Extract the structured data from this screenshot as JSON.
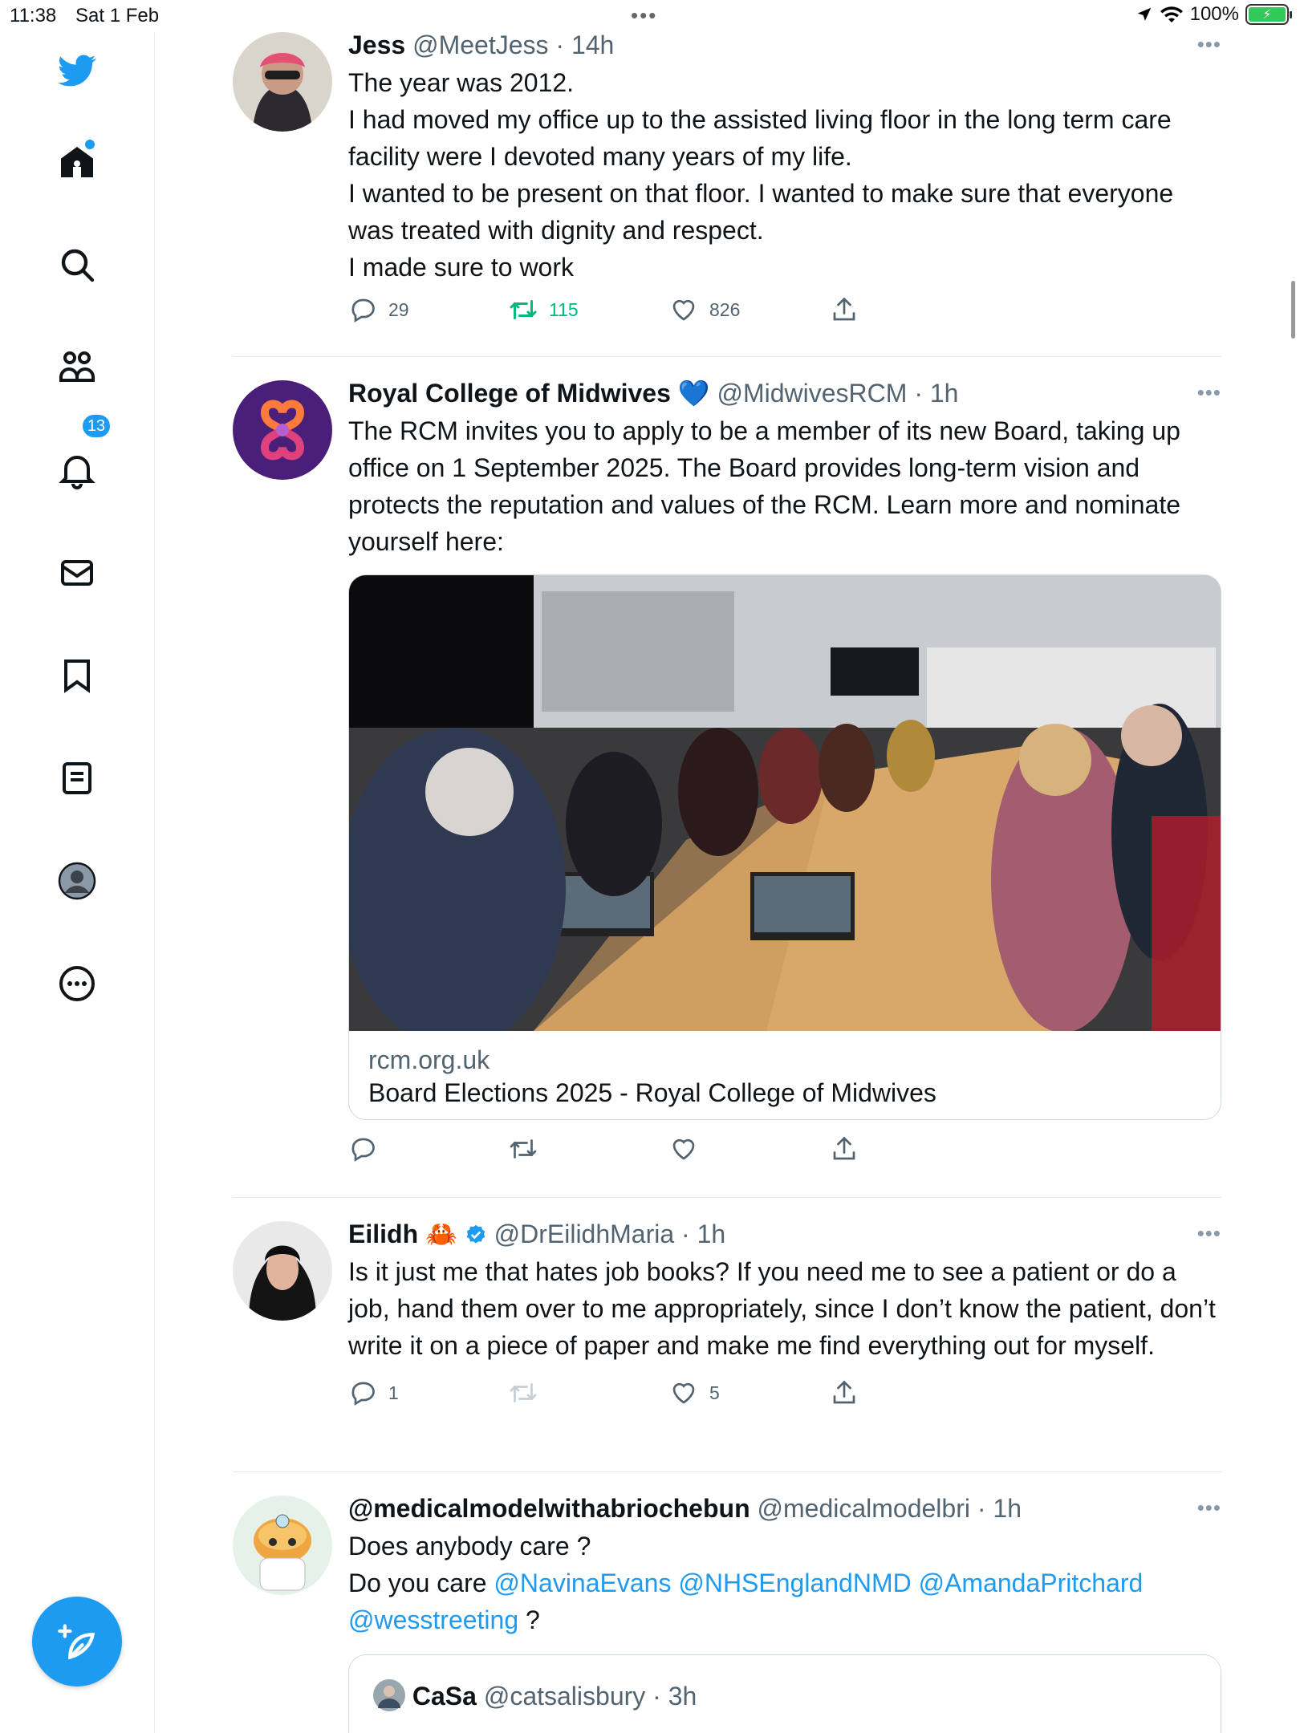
{
  "status_bar": {
    "time": "11:38",
    "date": "Sat 1 Feb",
    "battery": "100%"
  },
  "sidebar": {
    "items": [
      {
        "name": "home"
      },
      {
        "name": "explore"
      },
      {
        "name": "communities"
      },
      {
        "name": "notifications",
        "badge": "13"
      },
      {
        "name": "messages"
      },
      {
        "name": "bookmarks"
      },
      {
        "name": "lists"
      },
      {
        "name": "profile"
      },
      {
        "name": "more"
      }
    ]
  },
  "colors": {
    "accent": "#1d9bf0",
    "retweet": "#00ba7c",
    "text": "#0f1419",
    "secondary": "#536471"
  },
  "tweets": [
    {
      "name": "Jess",
      "handle": "@MeetJess",
      "time": "· 14h",
      "text_lines": [
        "The year was 2012.",
        "I had moved my office up to the assisted living floor in the long term care facility were I devoted many years of my life.",
        "I wanted to be present on that floor. I wanted to make sure that everyone was treated with dignity and respect.",
        "I made sure to work"
      ],
      "replies": "29",
      "retweets": "115",
      "likes": "826"
    },
    {
      "name": "Royal College of Midwives",
      "emoji": "💙",
      "handle": "@MidwivesRCM",
      "time": "· 1h",
      "text": "The RCM invites you to apply to be a member of its new Board, taking up office on 1 September 2025. The Board provides long-term vision and protects the reputation and values of the RCM. Learn more and nominate yourself here:",
      "card": {
        "domain": "rcm.org.uk",
        "title": "Board Elections 2025 - Royal College of Midwives"
      }
    },
    {
      "name": "Eilidh",
      "emoji": "🦀",
      "handle": "@DrEilidhMaria",
      "time": "· 1h",
      "text": "Is it just me that hates job books? If you need me to see a patient or do a job, hand them over to me appropriately, since I don’t know the patient, don’t write it on a piece of paper and make me find everything out for myself.",
      "replies": "1",
      "likes": "5"
    },
    {
      "name": "@medicalmodelwithabriochebun",
      "handle": "@medicalmodelbri",
      "time": "· 1h",
      "line1": "Does anybody care ?",
      "line2_prefix": "Do you care",
      "mentions": [
        "@NavinaEvans",
        "@NHSEnglandNMD",
        "@AmandaPritchard",
        "@wesstreeting"
      ],
      "line3_suffix": "?",
      "quote": {
        "name": "CaSa",
        "handle": "@catsalisbury",
        "time": "· 3h"
      }
    }
  ]
}
